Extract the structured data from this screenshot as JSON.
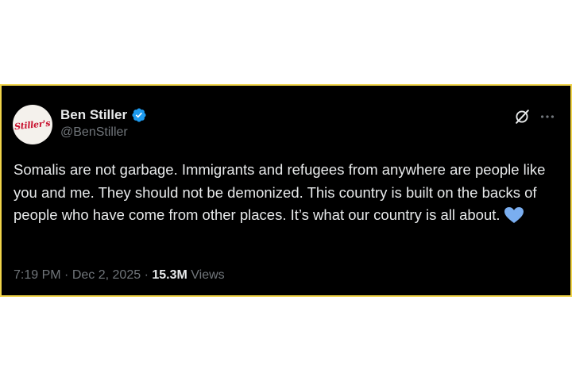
{
  "tweet": {
    "display_name": "Ben Stiller",
    "handle": "@BenStiller",
    "avatar_text": "Stiller's",
    "text": "Somalis are not garbage. Immigrants and refugees from anywhere are people like you and me. They should not be demonized. This country is built on the backs of people who have come from other places. It’s what our country is all about.",
    "emoji": "blue-heart",
    "time": "7:19 PM",
    "date": "Dec 2, 2025",
    "separator": "·",
    "views_count": "15.3M",
    "views_label": "Views"
  },
  "icons": {
    "verified": "verified-badge-icon",
    "grok": "grok-icon",
    "more": "more-icon",
    "heart": "blue-heart-icon"
  },
  "colors": {
    "background": "#000000",
    "border": "#f0d44a",
    "primary_text": "#e7e9ea",
    "secondary_text": "#71767b",
    "verified": "#1d9bf0",
    "heart": "#7aaef0",
    "avatar_logo": "#c8102e"
  }
}
